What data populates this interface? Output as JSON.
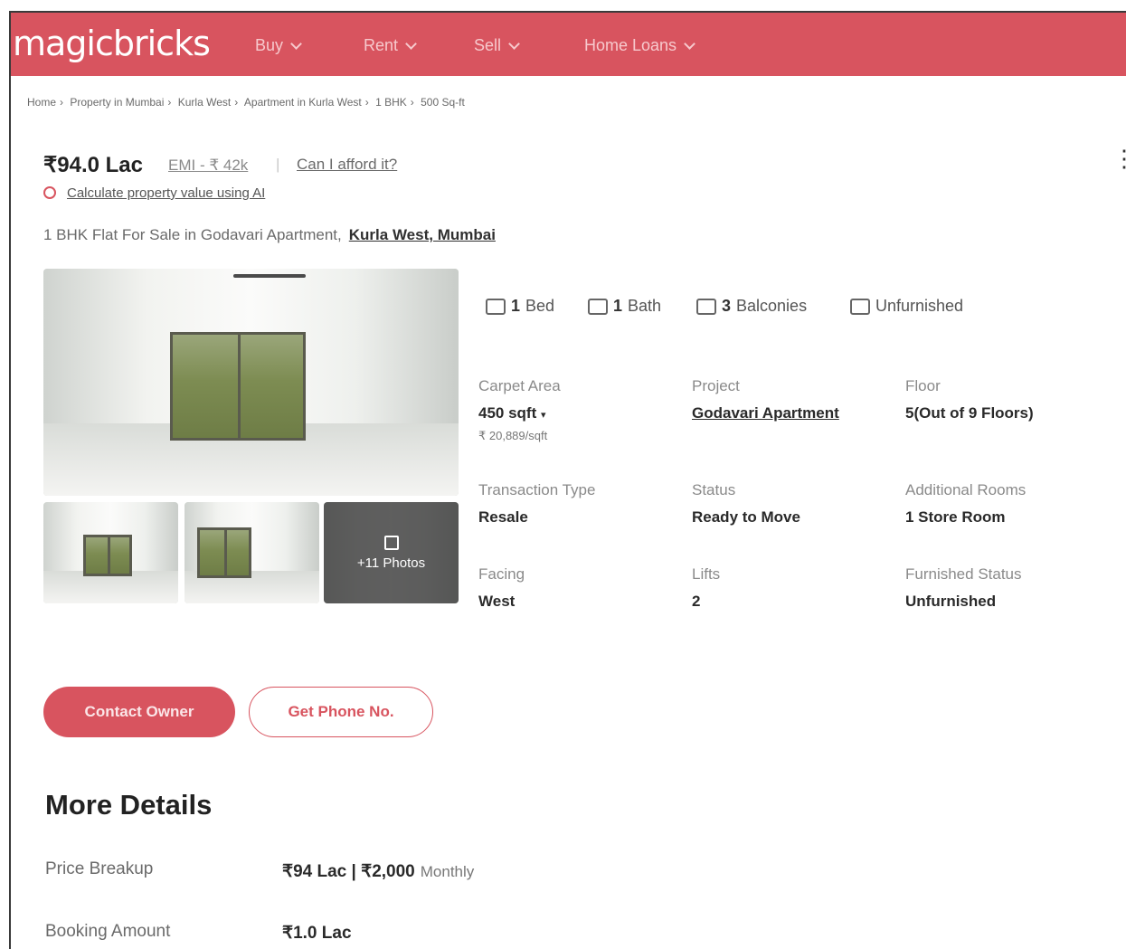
{
  "header": {
    "logo": "magicbricks",
    "nav": [
      {
        "label": "Buy"
      },
      {
        "label": "Rent"
      },
      {
        "label": "Sell"
      },
      {
        "label": "Home Loans"
      }
    ]
  },
  "breadcrumb": [
    "Home",
    "Property in Mumbai",
    "Kurla West",
    "Apartment in Kurla West",
    "1 BHK",
    "500 Sq-ft"
  ],
  "listing": {
    "price": "₹94.0 Lac",
    "emi": "EMI - ₹ 42k",
    "afford": "Can I afford it?",
    "calculate": "Calculate property value using AI",
    "title": "1 BHK Flat For Sale in Godavari Apartment,",
    "location": "Kurla West, Mumbai",
    "more_photos": "+11 Photos"
  },
  "amenities": {
    "bed": {
      "count": "1",
      "label": "Bed"
    },
    "bath": {
      "count": "1",
      "label": "Bath"
    },
    "balconies": {
      "count": "3",
      "label": "Balconies"
    },
    "furnishing": "Unfurnished"
  },
  "details": {
    "carpet_area_label": "Carpet Area",
    "carpet_area_value": "450 sqft",
    "carpet_area_rate": "₹ 20,889/sqft",
    "project_label": "Project",
    "project_value": "Godavari Apartment",
    "floor_label": "Floor",
    "floor_value": "5(Out of 9 Floors)",
    "transaction_label": "Transaction Type",
    "transaction_value": "Resale",
    "status_label": "Status",
    "status_value": "Ready to Move",
    "additional_label": "Additional Rooms",
    "additional_value": "1 Store Room",
    "facing_label": "Facing",
    "facing_value": "West",
    "lifts_label": "Lifts",
    "lifts_value": "2",
    "furnished_label": "Furnished Status",
    "furnished_value": "Unfurnished"
  },
  "actions": {
    "contact": "Contact Owner",
    "phone": "Get Phone No."
  },
  "more_details": {
    "title": "More Details",
    "price_breakup_label": "Price Breakup",
    "price_breakup_value": "₹94 Lac | ₹2,000",
    "price_breakup_suffix": "Monthly",
    "booking_label": "Booking Amount",
    "booking_value": "₹1.0 Lac"
  },
  "colors": {
    "brand": "#d8545f"
  }
}
